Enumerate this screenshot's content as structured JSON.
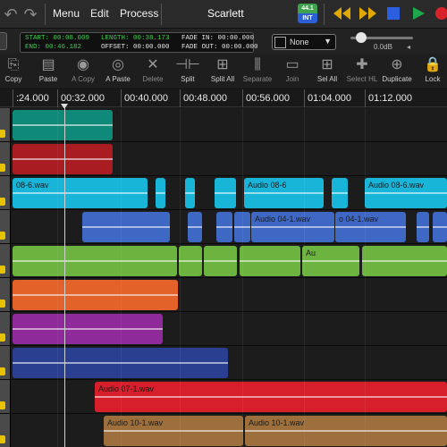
{
  "window": {
    "title": "Scarlett"
  },
  "nav": {
    "undo_glyph": "↶",
    "redo_glyph": "↷"
  },
  "menu": {
    "items": [
      "Menu",
      "Edit",
      "Process"
    ]
  },
  "rate_badge": {
    "rate": "44.1",
    "mode": "INT"
  },
  "transport": {
    "rewind_icon": "rewind-icon",
    "forward_icon": "fast-forward-icon",
    "stop_icon": "stop-icon",
    "play_icon": "play-icon",
    "record_icon": "record-icon"
  },
  "info": {
    "start_label": "START:",
    "start_value": "00:08.009",
    "end_label": "END:",
    "end_value": "00:46.182",
    "length_label": "LENGTH:",
    "length_value": "00:38.173",
    "offset_label": "OFFSET:",
    "offset_value": "00:00.000",
    "fade_in_label": "FADE IN:",
    "fade_in_value": "00:00.000",
    "fade_out_label": "FADE OUT:",
    "fade_out_value": "00:00.000"
  },
  "snap": {
    "value": "None"
  },
  "volume": {
    "readout": "0.0dB",
    "level_db": 0.0
  },
  "toolbar": [
    {
      "key": "copy",
      "label": "Copy",
      "icon": "copy-icon",
      "glyph": "⎘",
      "enabled": true
    },
    {
      "key": "paste",
      "label": "Paste",
      "icon": "paste-icon",
      "glyph": "▤",
      "enabled": true
    },
    {
      "key": "a-copy",
      "label": "A Copy",
      "icon": "audio-copy-icon",
      "glyph": "◉",
      "enabled": false
    },
    {
      "key": "a-paste",
      "label": "A Paste",
      "icon": "audio-paste-icon",
      "glyph": "◎",
      "enabled": true
    },
    {
      "key": "delete",
      "label": "Delete",
      "icon": "delete-icon",
      "glyph": "✕",
      "enabled": false
    },
    {
      "key": "split",
      "label": "Split",
      "icon": "split-icon",
      "glyph": "⊣⊢",
      "enabled": true
    },
    {
      "key": "split-all",
      "label": "Split All",
      "icon": "split-all-icon",
      "glyph": "⊞",
      "enabled": true
    },
    {
      "key": "separate",
      "label": "Separate",
      "icon": "separate-icon",
      "glyph": "⫼",
      "enabled": false
    },
    {
      "key": "join",
      "label": "Join",
      "icon": "join-icon",
      "glyph": "▭",
      "enabled": false
    },
    {
      "key": "sel-all",
      "label": "Sel All",
      "icon": "select-all-icon",
      "glyph": "⊞",
      "enabled": true
    },
    {
      "key": "select-hl",
      "label": "Select HL",
      "icon": "select-highlight-icon",
      "glyph": "✚",
      "enabled": false
    },
    {
      "key": "duplicate",
      "label": "Duplicate",
      "icon": "duplicate-icon",
      "glyph": "⊕",
      "enabled": true
    },
    {
      "key": "lock",
      "label": "Lock",
      "icon": "lock-icon",
      "glyph": "🔒",
      "enabled": true
    }
  ],
  "ruler": [
    ":24.000",
    "00:32.000",
    "00:40.000",
    "00:48.000",
    "00:56.000",
    "01:04.000",
    "01:12.000"
  ],
  "tracks": [
    {
      "color": "#0f8a78",
      "clips": [
        {
          "start": 14,
          "end": 126,
          "name": ""
        }
      ]
    },
    {
      "color": "#a81c22",
      "clips": [
        {
          "start": 14,
          "end": 126,
          "name": ""
        }
      ]
    },
    {
      "color": "#18b5d9",
      "clips": [
        {
          "start": 14,
          "end": 165,
          "name": "08-6.wav"
        },
        {
          "start": 174,
          "end": 185,
          "name": ""
        },
        {
          "start": 207,
          "end": 218,
          "name": ""
        },
        {
          "start": 240,
          "end": 264,
          "name": ""
        },
        {
          "start": 273,
          "end": 362,
          "name": "Audio 08-6"
        },
        {
          "start": 371,
          "end": 389,
          "name": ""
        },
        {
          "start": 408,
          "end": 500,
          "name": "Audio 08-6.wav"
        }
      ]
    },
    {
      "color": "#3f68c4",
      "clips": [
        {
          "start": 92,
          "end": 190,
          "name": ""
        },
        {
          "start": 210,
          "end": 226,
          "name": ""
        },
        {
          "start": 242,
          "end": 260,
          "name": ""
        },
        {
          "start": 262,
          "end": 280,
          "name": ""
        },
        {
          "start": 281,
          "end": 374,
          "name": "Audio 04-1.wav"
        },
        {
          "start": 375,
          "end": 454,
          "name": "o 04-1.wav"
        },
        {
          "start": 466,
          "end": 480,
          "name": ""
        },
        {
          "start": 484,
          "end": 500,
          "name": ""
        }
      ]
    },
    {
      "color": "#6db33f",
      "clips": [
        {
          "start": 14,
          "end": 198,
          "name": ""
        },
        {
          "start": 200,
          "end": 226,
          "name": ""
        },
        {
          "start": 228,
          "end": 265,
          "name": ""
        },
        {
          "start": 268,
          "end": 336,
          "name": ""
        },
        {
          "start": 338,
          "end": 402,
          "name": "Au"
        },
        {
          "start": 405,
          "end": 500,
          "name": ""
        }
      ]
    },
    {
      "color": "#e2622a",
      "clips": [
        {
          "start": 14,
          "end": 199,
          "name": ""
        }
      ]
    },
    {
      "color": "#8e2a9a",
      "clips": [
        {
          "start": 14,
          "end": 182,
          "name": ""
        }
      ]
    },
    {
      "color": "#2a3f8f",
      "clips": [
        {
          "start": 14,
          "end": 255,
          "name": ""
        }
      ]
    },
    {
      "color": "#d61f2a",
      "clips": [
        {
          "start": 106,
          "end": 500,
          "name": "Audio 07-1.wav"
        }
      ]
    },
    {
      "color": "#9c6f3d",
      "clips": [
        {
          "start": 116,
          "end": 272,
          "name": "Audio 10-1.wav"
        },
        {
          "start": 274,
          "end": 500,
          "name": "Audio 10-1.wav"
        }
      ]
    }
  ]
}
